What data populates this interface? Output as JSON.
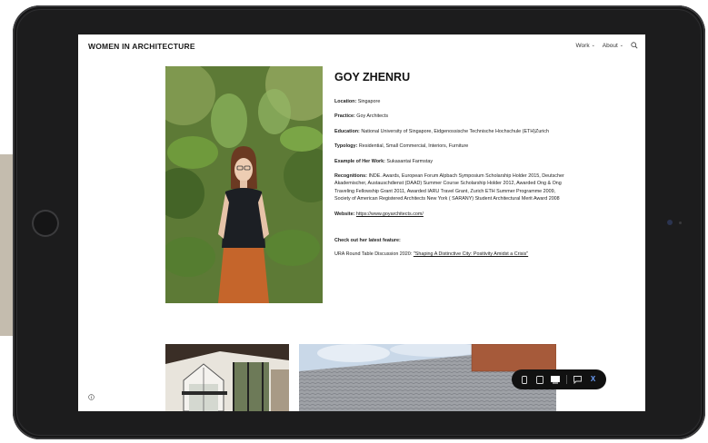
{
  "site": {
    "title": "WOMEN IN ARCHITECTURE"
  },
  "nav": {
    "work": "Work",
    "about": "About"
  },
  "profile": {
    "name": "GOY ZHENRU",
    "location_label": "Location:",
    "location": "Singapore",
    "practice_label": "Practice:",
    "practice": "Goy Architects",
    "education_label": "Education:",
    "education": "National University of Singapore, Eidgenossische Technische Hochschule (ETH)Zurich",
    "typology_label": "Typology:",
    "typology": "Residential, Small Commercial, Interiors, Furniture",
    "example_label": "Example of Her Work:",
    "example": "Sukasantai Farmstay",
    "recognitions_label": "Recognitions:",
    "recognitions": "INDE. Awards, European Forum Alpbach Symposium Scholarship Holder 2015, Deutscher Akademischer, Austauschdienst (DAAD) Summer Course Scholarship Holder 2012, Awarded Ong & Ong Traveling Fellowship Grant 2011, Awarded IARU Travel Grant, Zurich ETH Summer Programme 2009, Society of American Registered Architects New York ( SARANY) Student Architectural Merit Award 2008",
    "website_label": "Website:",
    "website": "https://www.goyarchitects.com/"
  },
  "feature": {
    "heading": "Check out her latest feature:",
    "prefix": "URA Round Table Discussion 2020:",
    "link": "\"Shaping A Distinctive City: Positivity Amidst a Crisis\""
  },
  "icons": {
    "search": "search-icon",
    "info": "info-icon",
    "phone": "phone-view-icon",
    "tablet": "tablet-view-icon",
    "desktop": "desktop-view-icon",
    "comment": "comment-icon",
    "close": "close-icon"
  },
  "colors": {
    "bezel": "#1c1c1d",
    "toolbar": "#111111",
    "close_accent": "#6ea2ff",
    "side_strip": "#c4bcae"
  },
  "toolbar": {
    "close": "X"
  }
}
